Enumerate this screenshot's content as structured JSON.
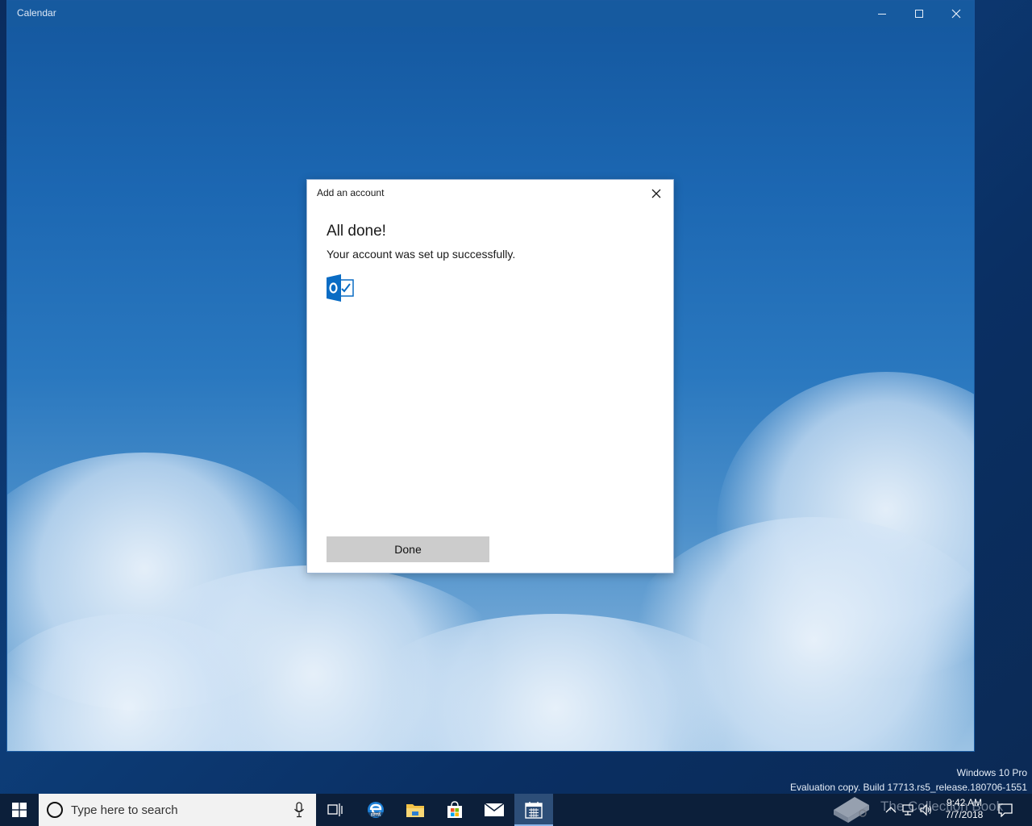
{
  "window": {
    "title": "Calendar"
  },
  "dialog": {
    "title": "Add an account",
    "heading": "All done!",
    "message": "Your account was set up successfully.",
    "account_icon": "outlook-icon",
    "done_label": "Done"
  },
  "watermark": {
    "edition": "Windows 10 Pro",
    "build": "Evaluation copy. Build 17713.rs5_release.180706-1551",
    "logo_text": "The Collection Book"
  },
  "taskbar": {
    "search_placeholder": "Type here to search",
    "apps": [
      "task-view",
      "edge",
      "file-explorer",
      "store",
      "mail",
      "calendar"
    ],
    "active_app": "calendar",
    "time": "9:42 AM",
    "date": "7/7/2018"
  },
  "colors": {
    "titlebar": "#165a9f",
    "taskbar": "#0c1f3a",
    "outlook_blue": "#0a6cc4",
    "done_button": "#cccccc"
  }
}
